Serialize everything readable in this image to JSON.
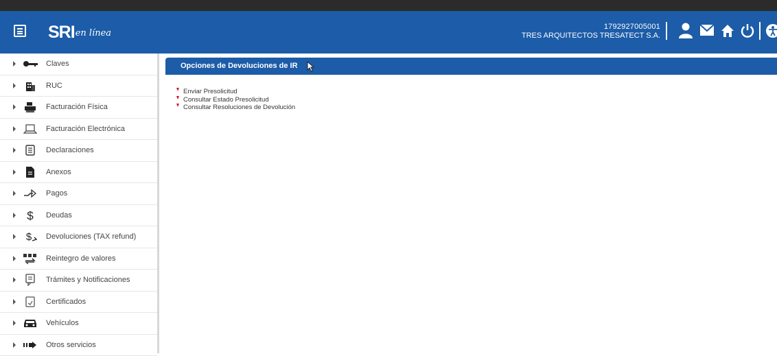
{
  "header": {
    "logo": {
      "brand": "SRI",
      "tagline": "en línea"
    },
    "taxpayer_id": "1792927005001",
    "taxpayer_name": "TRES ARQUITECTOS TRESATECT S.A.",
    "accent_color": "#1c5ca8",
    "icons": [
      "menu-icon",
      "user-icon",
      "mail-icon",
      "home-icon",
      "power-icon",
      "accessibility-icon"
    ]
  },
  "sidebar": {
    "items": [
      {
        "label": "Claves",
        "icon": "key-icon"
      },
      {
        "label": "RUC",
        "icon": "building-icon"
      },
      {
        "label": "Facturación Física",
        "icon": "printer-icon"
      },
      {
        "label": "Facturación Electrónica",
        "icon": "laptop-icon"
      },
      {
        "label": "Declaraciones",
        "icon": "document-icon"
      },
      {
        "label": "Anexos",
        "icon": "file-icon"
      },
      {
        "label": "Pagos",
        "icon": "payment-hand-icon"
      },
      {
        "label": "Deudas",
        "icon": "dollar-icon"
      },
      {
        "label": "Devoluciones (TAX refund)",
        "icon": "dollar-return-icon"
      },
      {
        "label": "Reintegro de valores",
        "icon": "refund-icon"
      },
      {
        "label": "Trámites y Notificaciones",
        "icon": "notification-icon"
      },
      {
        "label": "Certificados",
        "icon": "certificate-icon"
      },
      {
        "label": "Vehículos",
        "icon": "car-icon"
      },
      {
        "label": "Otros servicios",
        "icon": "services-icon"
      }
    ]
  },
  "main": {
    "section_title": "Opciones de Devoluciones de IR",
    "links": [
      "Enviar Presolicitud",
      "Consultar Estado Presolicitud",
      "Consultar Resoluciones de Devolución"
    ],
    "bullet_color": "#d3172b"
  }
}
